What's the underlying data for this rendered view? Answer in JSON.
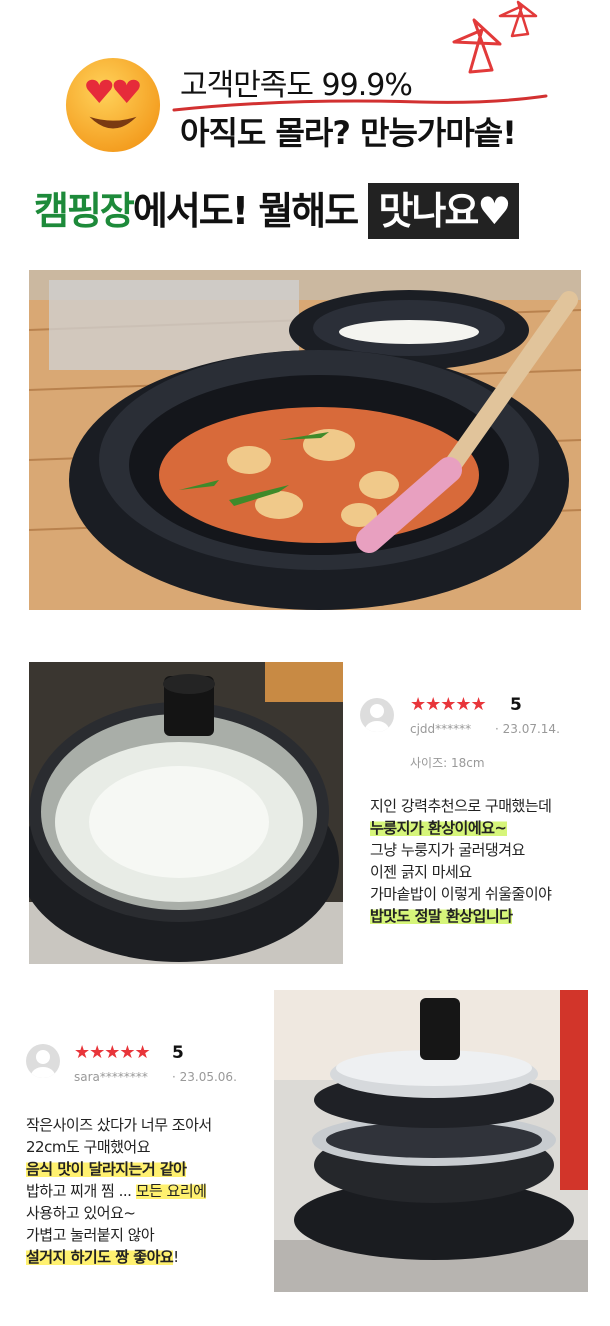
{
  "header": {
    "line1": "고객만족도 99.9%",
    "line2": "아직도 몰라? 만능가마솥!",
    "banner_green": "캠핑장",
    "banner_mid": "에서도! 뭘해도 ",
    "banner_boxed": "맛나요♥"
  },
  "colors": {
    "accent_green": "#1d8a3a",
    "star_red": "#e8353a",
    "highlight_green": "#d6f57a",
    "highlight_yellow": "#fff170"
  },
  "icons": [
    "heart-eyes-emoji-icon",
    "star-doodle-icon",
    "avatar-icon",
    "rating-star-icon"
  ],
  "review1": {
    "rating_stars": "★★★★★",
    "score": "5",
    "user": "cjdd******",
    "date": "· 23.07.14.",
    "size": "사이즈: 18cm",
    "lines": [
      "지인 강력추천으로 구매했는데",
      "누룽지가 환상이에요~",
      "그냥 누룽지가 굴러댕겨요",
      "이젠 긁지 마세요",
      "가마솥밥이 이렇게 쉬울줄이야",
      "밥맛도 정말 환상입니다"
    ]
  },
  "review2": {
    "rating_stars": "★★★★★",
    "score": "5",
    "user": "sara********",
    "date": "· 23.05.06.",
    "lines": [
      "작은사이즈 샀다가 너무 조아서",
      "22cm도 구매했어요",
      "음식 맛이 달라지는거 같아",
      "밥하고 찌개 찜 ... ",
      "모든 요리에",
      "사용하고 있어요~",
      "가볍고 눌러붙지 않아",
      "설거지 하기도 짱 좋아요",
      "!"
    ]
  }
}
